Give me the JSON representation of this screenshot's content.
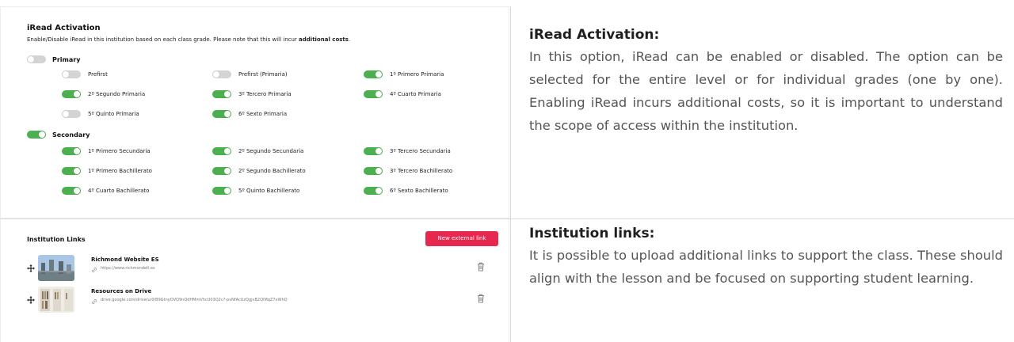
{
  "iread": {
    "title": "iRead Activation",
    "desc_before": "Enable/Disable iRead in this institution based on each class grade. Please note that this will incur ",
    "desc_bold": "additional costs",
    "desc_after": ".",
    "levels": [
      {
        "label": "Primary",
        "enabled": false,
        "grades": [
          {
            "label": "Prefirst",
            "enabled": false
          },
          {
            "label": "Prefirst (Primaria)",
            "enabled": false
          },
          {
            "label": "1º Primero Primaria",
            "enabled": true
          },
          {
            "label": "2º Segundo Primaria",
            "enabled": true
          },
          {
            "label": "3º Tercero Primaria",
            "enabled": true
          },
          {
            "label": "4º Cuarto Primaria",
            "enabled": true
          },
          {
            "label": "5º Quinto Primaria",
            "enabled": false
          },
          {
            "label": "6º Sexto Primaria",
            "enabled": true
          }
        ]
      },
      {
        "label": "Secondary",
        "enabled": true,
        "grades": [
          {
            "label": "1º Primero Secundaria",
            "enabled": true
          },
          {
            "label": "2º Segundo Secundaria",
            "enabled": true
          },
          {
            "label": "3º Tercero Secundaria",
            "enabled": true
          },
          {
            "label": "1º Primero Bachillerato",
            "enabled": true
          },
          {
            "label": "2º Segundo Bachillerato",
            "enabled": true
          },
          {
            "label": "3º Tercero Bachillerato",
            "enabled": true
          },
          {
            "label": "4º Cuarto Bachillerato",
            "enabled": true
          },
          {
            "label": "5º Quinto Bachillerato",
            "enabled": true
          },
          {
            "label": "6º Sexto Bachillerato",
            "enabled": true
          }
        ]
      }
    ]
  },
  "links": {
    "title": "Institution Links",
    "new_button": "New external link",
    "items": [
      {
        "name": "Richmond Website ES",
        "url": "https://www.richmondelt.es"
      },
      {
        "name": "Resources on Drive",
        "url": "drive.google.com/drive/u/0/B9GtnyOVQ9nQdHMmVhcU03Q2c?-pvNfAcUzQgjvB2QlMqZ7xWhQ"
      }
    ]
  },
  "explain": {
    "iread_heading": "iRead Activation:",
    "iread_text": "In this option, iRead can be enabled or disabled. The option can be selected for the entire level or for individual grades (one by one). Enabling iRead incurs additional costs, so it is important to understand the scope of access within the institution.",
    "links_heading": "Institution links:",
    "links_text": "It is possible to upload additional links to support the class. These should align with the lesson and be focused on supporting student learning."
  },
  "colors": {
    "toggle_on": "#4caf50",
    "toggle_off": "#d4d4d4",
    "accent_button": "#e8274e"
  }
}
